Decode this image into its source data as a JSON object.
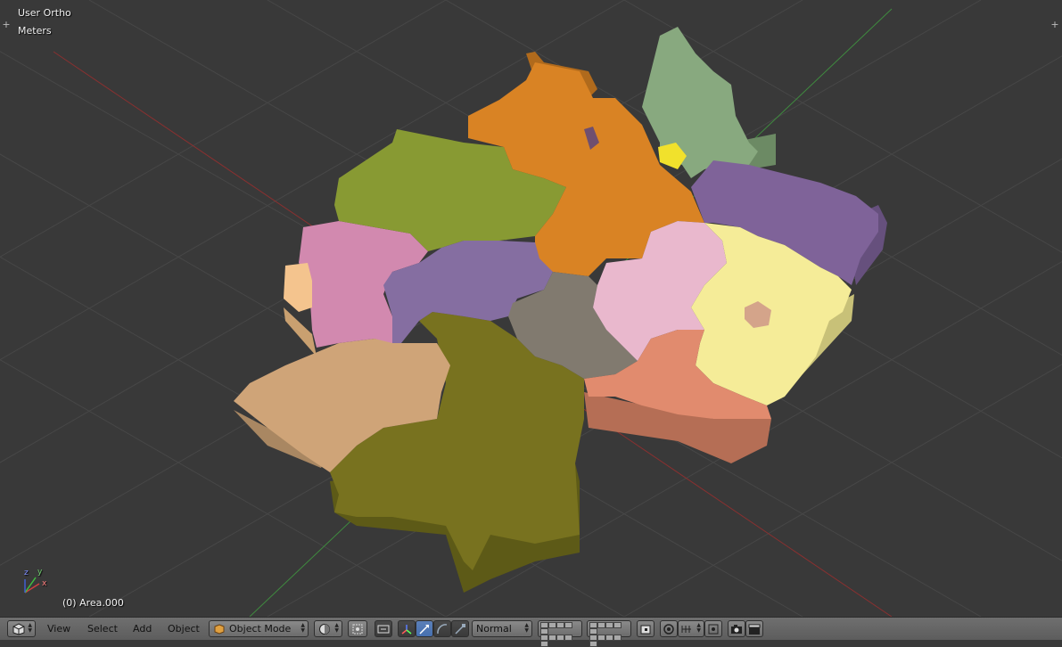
{
  "viewport": {
    "view_name": "User Ortho",
    "units": "Meters",
    "object_info": "(0) Area.000",
    "axis_labels": {
      "x": "x",
      "y": "y",
      "z": "z"
    },
    "colors": {
      "background": "#393939",
      "grid": "#474747",
      "x_axis": "#8a3030",
      "y_axis": "#3f8a3f"
    },
    "regions": [
      {
        "name": "north-west",
        "color": "#889a33"
      },
      {
        "name": "north",
        "color": "#d98324"
      },
      {
        "name": "north-east",
        "color": "#88a97f"
      },
      {
        "name": "small-yellow",
        "color": "#f1e12c"
      },
      {
        "name": "east-north",
        "color": "#7f6399"
      },
      {
        "name": "west",
        "color": "#d289af"
      },
      {
        "name": "west-small",
        "color": "#f4c48e"
      },
      {
        "name": "center",
        "color": "#856ea1"
      },
      {
        "name": "center-gray",
        "color": "#817a6f"
      },
      {
        "name": "center-pink",
        "color": "#e9b8cd"
      },
      {
        "name": "east",
        "color": "#f5ec98"
      },
      {
        "name": "south-east",
        "color": "#e18b6e"
      },
      {
        "name": "south-west",
        "color": "#cfa478"
      },
      {
        "name": "south",
        "color": "#78721f"
      }
    ]
  },
  "header": {
    "menus": [
      "View",
      "Select",
      "Add",
      "Object"
    ],
    "mode": "Object Mode",
    "orientation": "Normal"
  }
}
